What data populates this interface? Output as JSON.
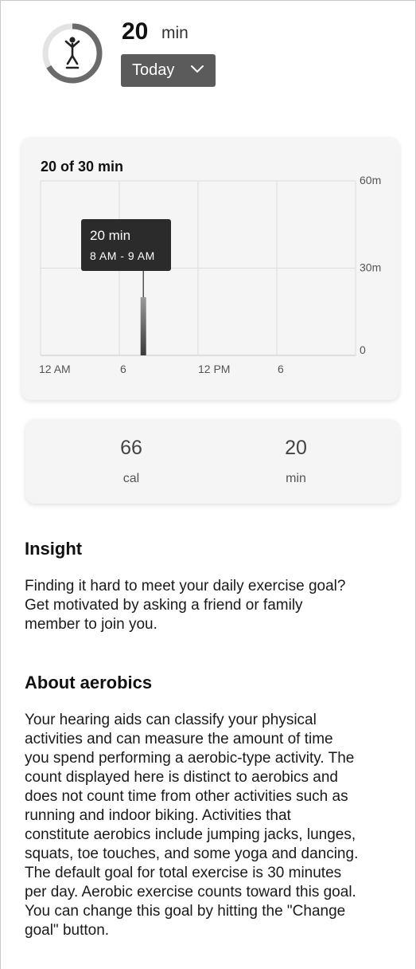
{
  "header": {
    "ring_icon": "jumping-jack-icon",
    "value": "20",
    "unit": "min",
    "range_label": "Today",
    "progress_fraction": 0.667
  },
  "chart_data": {
    "type": "bar",
    "title": "20 of 30 min",
    "x_tick_labels": [
      "12 AM",
      "6",
      "12 PM",
      "6"
    ],
    "y_tick_labels": [
      "60m",
      "30m",
      "0"
    ],
    "ylim": [
      0,
      60
    ],
    "x": [
      "7 AM"
    ],
    "values": [
      20
    ],
    "tooltip": {
      "value": "20 min",
      "range": "8 AM - 9 AM"
    },
    "grid": true
  },
  "stats": [
    {
      "value": "66",
      "unit": "cal"
    },
    {
      "value": "20",
      "unit": "min"
    }
  ],
  "insight": {
    "heading": "Insight",
    "lines": [
      "Finding it hard to meet your daily exercise goal?",
      "Get motivated by asking a friend or family",
      "member to join you."
    ]
  },
  "about": {
    "heading": "About aerobics",
    "lines": [
      "Your hearing aids can classify your physical",
      "activities and can measure the amount of time",
      "you spend performing a aerobic-type activity. The",
      "count displayed here is distinct to aerobics and",
      "does not count time from other activities such as",
      "running and indoor biking. Activities that",
      "constitute aerobics include jumping jacks, lunges,",
      "squats, toe touches, and some yoga and dancing.",
      "The default goal for total exercise is 30 minutes",
      "per day. Aerobic exercise counts toward this goal.",
      "You can change this goal by hitting the \"Change",
      "goal\" button."
    ]
  },
  "colors": {
    "ring_track": "#e3e3e3",
    "ring_progress": "#6a6a6a",
    "tooltip_bg": "#2b2b2b",
    "button_bg": "#5b5b5b"
  }
}
